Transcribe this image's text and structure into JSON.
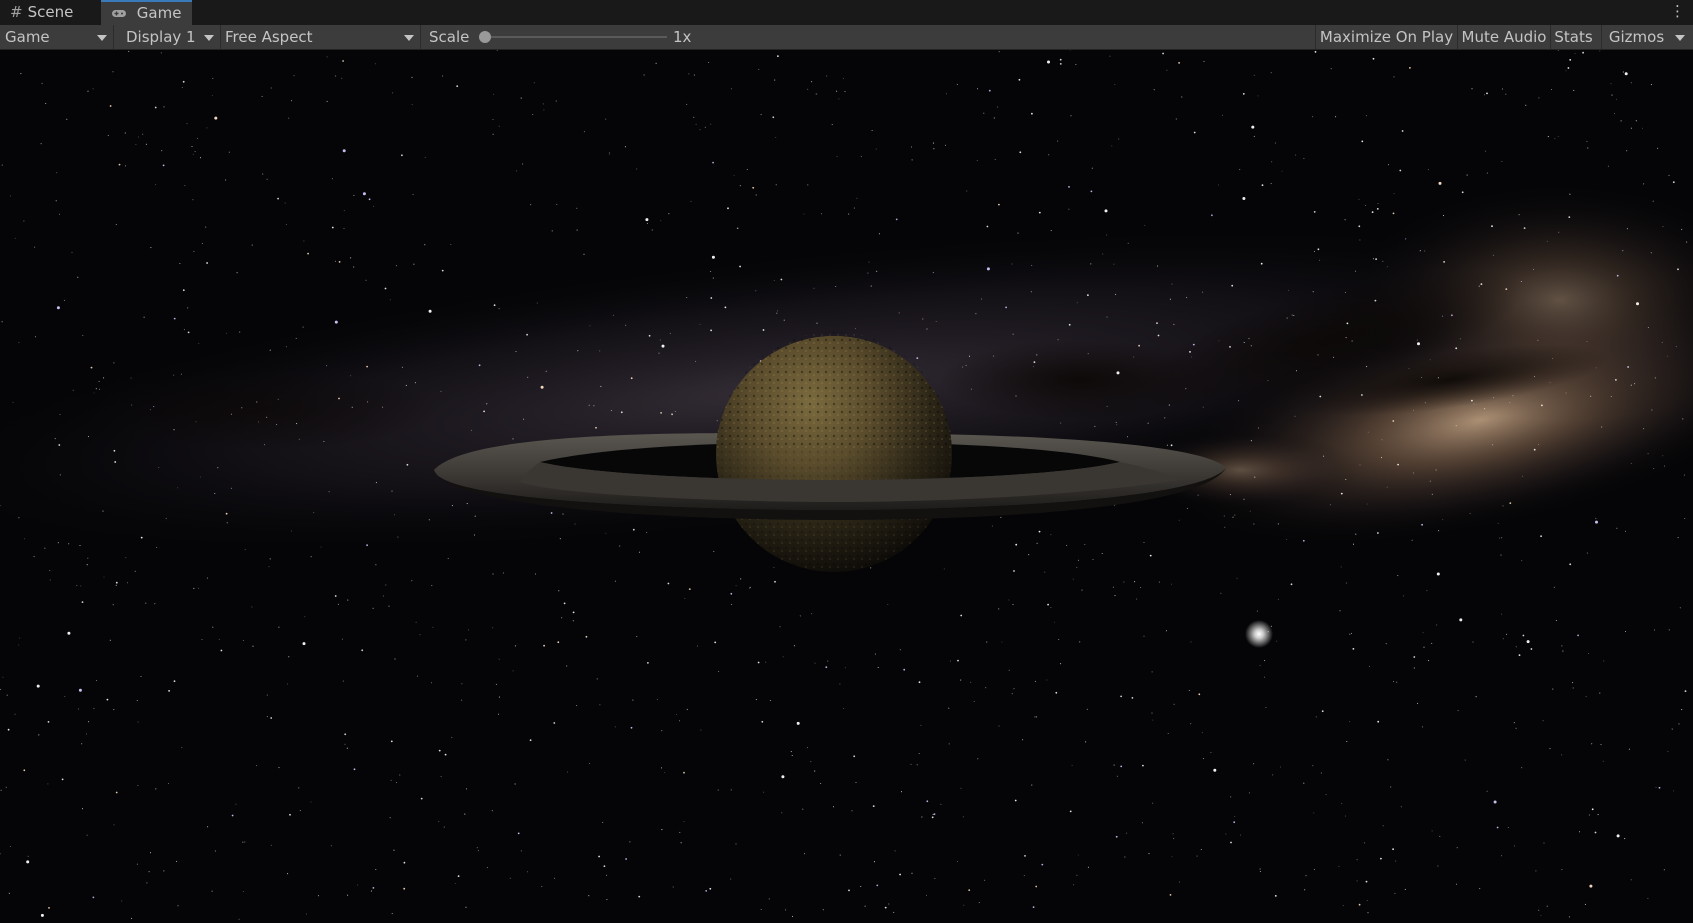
{
  "tabs": {
    "scene": {
      "label": "Scene",
      "icon": "grid-icon"
    },
    "game": {
      "label": "Game",
      "icon": "gamepad-icon",
      "active": true
    }
  },
  "toolbar": {
    "view_dropdown": "Game",
    "display_dropdown": "Display 1",
    "aspect_dropdown": "Free Aspect",
    "scale_label": "Scale",
    "scale_value": "1x",
    "scale_fraction": 0,
    "maximize_on_play": "Maximize On Play",
    "mute_audio": "Mute Audio",
    "stats": "Stats",
    "gizmos": "Gizmos"
  },
  "viewport": {
    "scene_objects": [
      "planet",
      "planet-ring",
      "milky-way-skybox",
      "bright-star"
    ]
  },
  "colors": {
    "panel": "#3c3c3c",
    "tabbar": "#191919",
    "active_tab_accent": "#3a79bb",
    "text": "#c4c4c4"
  }
}
